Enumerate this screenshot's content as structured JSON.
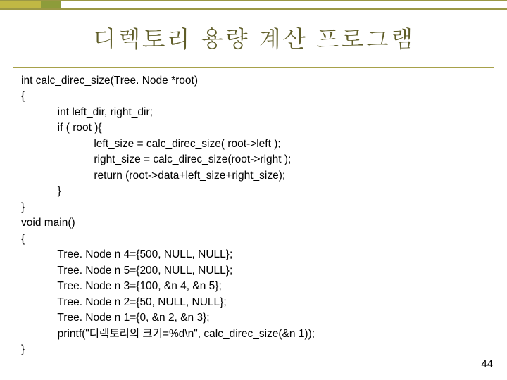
{
  "slide": {
    "title": "디렉토리 용량 계산 프로그램",
    "page_number": "44"
  },
  "code": {
    "l1": "int calc_direc_size(Tree. Node *root)",
    "l2": "{",
    "l3": "            int left_dir, right_dir;",
    "l4": "            if ( root ){",
    "l5": "                        left_size = calc_direc_size( root->left );",
    "l6": "                        right_size = calc_direc_size(root->right );",
    "l7": "                        return (root->data+left_size+right_size);",
    "l8": "            }",
    "l9": "}",
    "l10": "void main()",
    "l11": "{",
    "l12": "            Tree. Node n 4={500, NULL, NULL};",
    "l13": "            Tree. Node n 5={200, NULL, NULL};",
    "l14": "            Tree. Node n 3={100, &n 4, &n 5};",
    "l15": "            Tree. Node n 2={50, NULL, NULL};",
    "l16": "            Tree. Node n 1={0, &n 2, &n 3};",
    "l17": "            printf(\"디렉토리의 크기=%d\\n\", calc_direc_size(&n 1));",
    "l18": "}"
  }
}
